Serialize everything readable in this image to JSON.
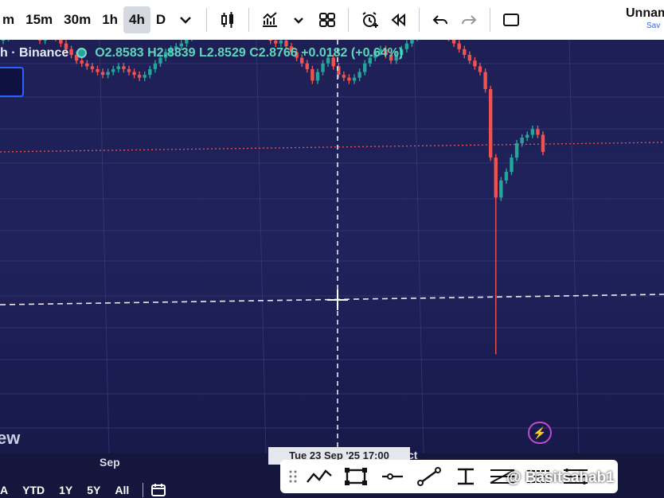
{
  "toolbar": {
    "timeframes": [
      "m",
      "15m",
      "30m",
      "1h",
      "4h",
      "D"
    ],
    "active_timeframe": "4h",
    "icons": [
      "chevron-down-icon",
      "candles-icon",
      "indicators-icon",
      "chevron-down-icon",
      "layout-grid-icon",
      "alert-add-icon",
      "replay-icon",
      "undo-icon",
      "redo-icon",
      "fullscreen-icon"
    ],
    "layout_title": "Unnam",
    "layout_subtitle": "Sav"
  },
  "legend": {
    "symbol": "h · Binance",
    "open": "O2.8583",
    "high": "H2.8839",
    "low": "L2.8529",
    "close": "C2.8766",
    "change": "+0.0182",
    "change_pct": "(+0.64%)"
  },
  "watermark": "ew",
  "time_axis": {
    "ticks": [
      "Sep",
      "ct"
    ],
    "crosshair_label": "Tue 23 Sep '25   17:00"
  },
  "ranges": [
    "A",
    "YTD",
    "1Y",
    "5Y",
    "All"
  ],
  "credit": "@ Basitsahab1",
  "colors": {
    "up": "#26a69a",
    "down": "#ef5350",
    "background": "#1d1f55"
  },
  "chart_data": {
    "type": "candlestick",
    "ohlc_last": {
      "open": 2.8583,
      "high": 2.8839,
      "low": 2.8529,
      "close": 2.8766
    },
    "change": 0.0182,
    "change_pct": 0.64,
    "closes": [
      3.42,
      3.45,
      3.47,
      3.46,
      3.44,
      3.46,
      3.43,
      3.41,
      3.43,
      3.44,
      3.42,
      3.4,
      3.38,
      3.36,
      3.34,
      3.33,
      3.32,
      3.31,
      3.3,
      3.29,
      3.3,
      3.31,
      3.32,
      3.31,
      3.3,
      3.29,
      3.28,
      3.29,
      3.31,
      3.33,
      3.35,
      3.37,
      3.38,
      3.39,
      3.4,
      3.42,
      3.44,
      3.46,
      3.48,
      3.49,
      3.47,
      3.46,
      3.45,
      3.44,
      3.43,
      3.44,
      3.45,
      3.46,
      3.47,
      3.45,
      3.43,
      3.41,
      3.4,
      3.41,
      3.39,
      3.37,
      3.35,
      3.33,
      3.31,
      3.27,
      3.3,
      3.33,
      3.35,
      3.32,
      3.29,
      3.28,
      3.27,
      3.28,
      3.3,
      3.33,
      3.35,
      3.37,
      3.38,
      3.36,
      3.34,
      3.36,
      3.38,
      3.4,
      3.42,
      3.44,
      3.46,
      3.45,
      3.44,
      3.45,
      3.44,
      3.42,
      3.4,
      3.38,
      3.36,
      3.34,
      3.32,
      3.3,
      3.24,
      3.0,
      2.86,
      2.92,
      2.95,
      3.0,
      3.05,
      3.07,
      3.08,
      3.1,
      3.08,
      3.02
    ],
    "spike_low": 2.31
  }
}
